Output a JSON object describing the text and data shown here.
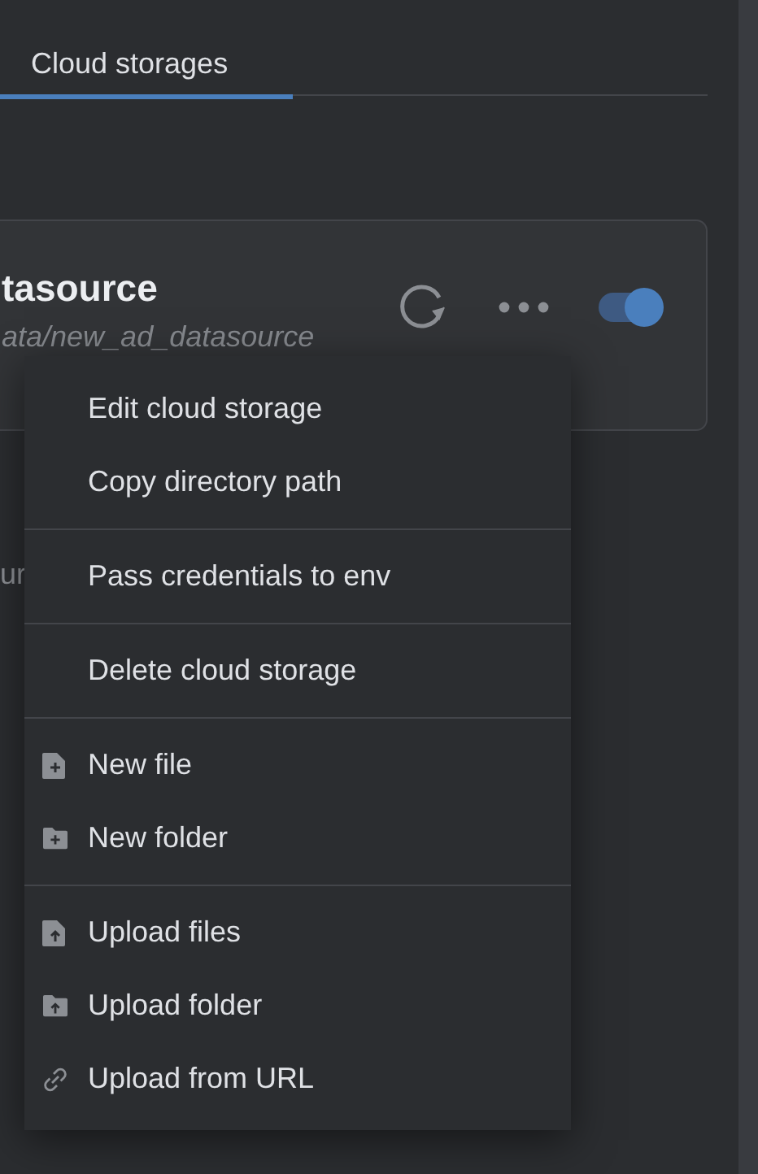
{
  "tabs": [
    {
      "label": "Cloud storages",
      "selected": true
    }
  ],
  "storage_card": {
    "title": "tasource",
    "path": "ata/new_ad_datasource",
    "enabled": true
  },
  "below_text": "ur",
  "context_menu": {
    "groups": [
      [
        {
          "label": "Edit cloud storage",
          "kind": "plain"
        },
        {
          "label": "Copy directory path",
          "kind": "plain"
        }
      ],
      [
        {
          "label": "Pass credentials to env",
          "kind": "plain"
        }
      ],
      [
        {
          "label": "Delete cloud storage",
          "kind": "plain"
        }
      ],
      [
        {
          "label": "New file",
          "kind": "new_file"
        },
        {
          "label": "New folder",
          "kind": "new_folder"
        }
      ],
      [
        {
          "label": "Upload files",
          "kind": "upload_file"
        },
        {
          "label": "Upload folder",
          "kind": "upload_folder"
        },
        {
          "label": "Upload from URL",
          "kind": "link"
        }
      ]
    ]
  }
}
